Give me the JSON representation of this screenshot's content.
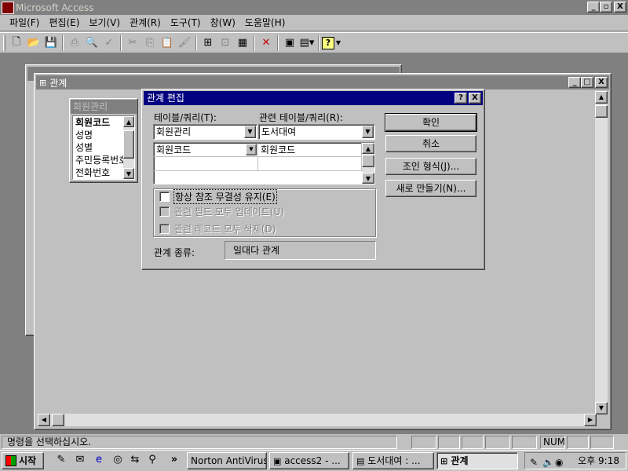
{
  "app": {
    "title": "Microsoft Access",
    "min": "_",
    "restore": "▫",
    "close": "X"
  },
  "menu": [
    "파일(F)",
    "편집(E)",
    "보기(V)",
    "관계(R)",
    "도구(T)",
    "창(W)",
    "도움말(H)"
  ],
  "toolbar": {
    "icons": [
      "new-icon",
      "open-icon",
      "save-icon",
      "print-icon",
      "print-preview-icon",
      "spelling-icon",
      "cut-icon",
      "copy-icon",
      "paste-icon",
      "format-painter-icon",
      "show-table-icon",
      "show-direct-icon",
      "show-all-icon",
      "delete-icon",
      "database-window-icon",
      "new-object-icon",
      "help-icon"
    ]
  },
  "relationships_window": {
    "title": "관계"
  },
  "field_list": {
    "title": "회원관리",
    "fields": [
      "회원코드",
      "성명",
      "성별",
      "주민등록번호",
      "전화번호"
    ]
  },
  "dialog": {
    "title": "관계 편집",
    "help": "?",
    "close": "X",
    "table_label": "테이블/쿼리(T):",
    "related_label": "관련 테이블/쿼리(R):",
    "table_value": "회원관리",
    "related_value": "도서대여",
    "field_left": "회원코드",
    "field_right": "회원코드",
    "buttons": {
      "ok": "확인",
      "cancel": "취소",
      "join": "조인 형식(J)...",
      "create_new": "새로 만들기(N)..."
    },
    "integrity": "항상 참조 무결성 유지(E)",
    "cascade_update": "관련 필드 모두 업데이트(U)",
    "cascade_delete": "관련 레코드 모두 삭제(D)",
    "rel_type_label": "관계 종류:",
    "rel_type_value": "일대다 관계"
  },
  "status": {
    "message": "명령을 선택하십시오.",
    "num": "NUM"
  },
  "taskbar": {
    "start": "시작",
    "tasks": [
      "Norton AntiVirus",
      "access2 - ...",
      "도서대여 : ...",
      "관계"
    ],
    "clock": "오후 9:18",
    "more": "»"
  }
}
